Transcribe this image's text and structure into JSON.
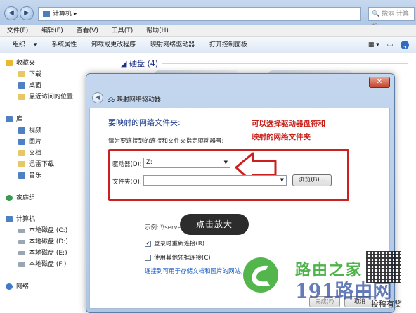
{
  "explorer": {
    "address": "计算机",
    "search_placeholder": "搜索 计算机",
    "menu": [
      "文件(F)",
      "编辑(E)",
      "查看(V)",
      "工具(T)",
      "帮助(H)"
    ],
    "toolbar": [
      "组织",
      "系统属性",
      "卸载或更改程序",
      "映射网络驱动器",
      "打开控制面板"
    ],
    "sidebar": {
      "favorites": "收藏夹",
      "favorites_items": [
        "下载",
        "桌面",
        "最近访问的位置"
      ],
      "library": "库",
      "library_items": [
        "视频",
        "图片",
        "文档",
        "迅雷下载",
        "音乐"
      ],
      "homegroup": "家庭组",
      "computer": "计算机",
      "computer_items": [
        "本地磁盘 (C:)",
        "本地磁盘 (D:)",
        "本地磁盘 (E:)",
        "本地磁盘 (F:)"
      ],
      "network": "网络"
    },
    "hdd_header": "硬盘 (4)"
  },
  "dialog": {
    "title": "映射网络驱动器",
    "heading": "要映射的网络文件夹:",
    "subtext": "请为要连接到的连接和文件夹指定驱动器号:",
    "drive_label": "驱动器(D):",
    "drive_value": "Z:",
    "folder_label": "文件夹(O):",
    "folder_value": "",
    "browse_label": "浏览(B)...",
    "example": "示例: \\\\server\\share",
    "reconnect_label": "登录时重新连接(R)",
    "reconnect_checked": true,
    "credentials_label": "使用其他凭据连接(C)",
    "credentials_checked": false,
    "link_text": "连接到可用于存储文档和图片的网站。",
    "finish_label": "完成(F)",
    "cancel_label": "取消"
  },
  "annotation": {
    "line1": "可以选择驱动器盘符和",
    "line2": "映射的网络文件夹",
    "color": "#c9201a"
  },
  "tooltip": "点击放大",
  "watermark": {
    "cn_name": "路由之家",
    "site": "191路由网",
    "tagline": "投稿有奖"
  }
}
